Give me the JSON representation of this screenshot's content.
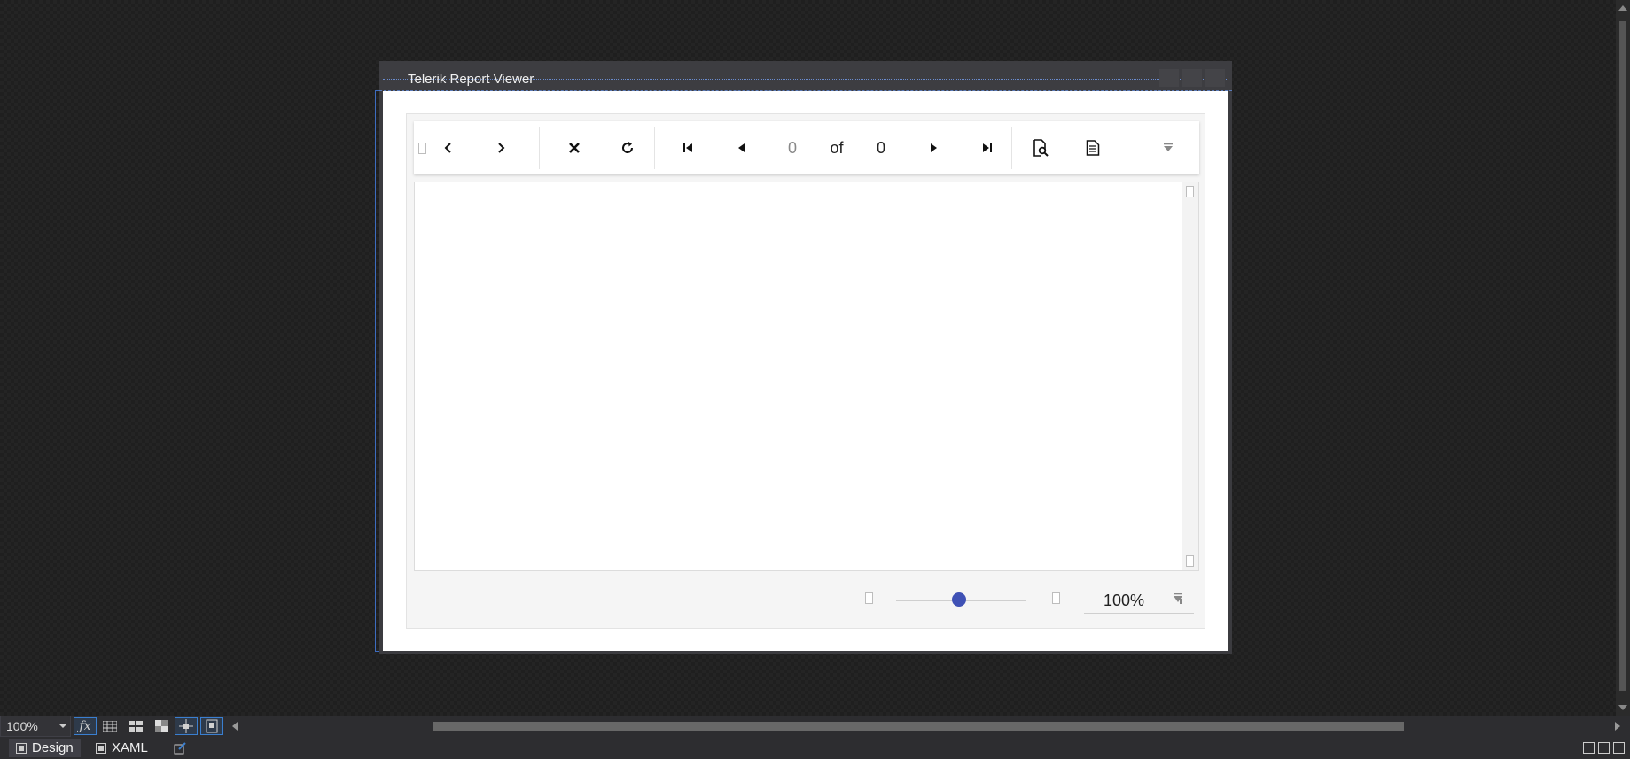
{
  "window": {
    "title": "Telerik Report Viewer"
  },
  "toolbar": {
    "current_page": "0",
    "of_label": "of",
    "total_pages": "0",
    "icons": [
      "toggle-panel-icon",
      "back-icon",
      "forward-icon",
      "stop-icon",
      "refresh-icon",
      "first-page-icon",
      "previous-page-icon",
      "next-page-icon",
      "last-page-icon",
      "print-preview-icon",
      "export-icon",
      "overflow-dropdown-icon"
    ]
  },
  "zoom_bar": {
    "zoom_value": "100%",
    "slider_level_percent": 50
  },
  "designer": {
    "zoom_value": "100%",
    "tabs": {
      "design": "Design",
      "xaml": "XAML"
    },
    "accent_color": "#3a7fd0"
  },
  "colors": {
    "slider_thumb": "#3f51b5",
    "window_title_bg": "#3d3d41"
  }
}
